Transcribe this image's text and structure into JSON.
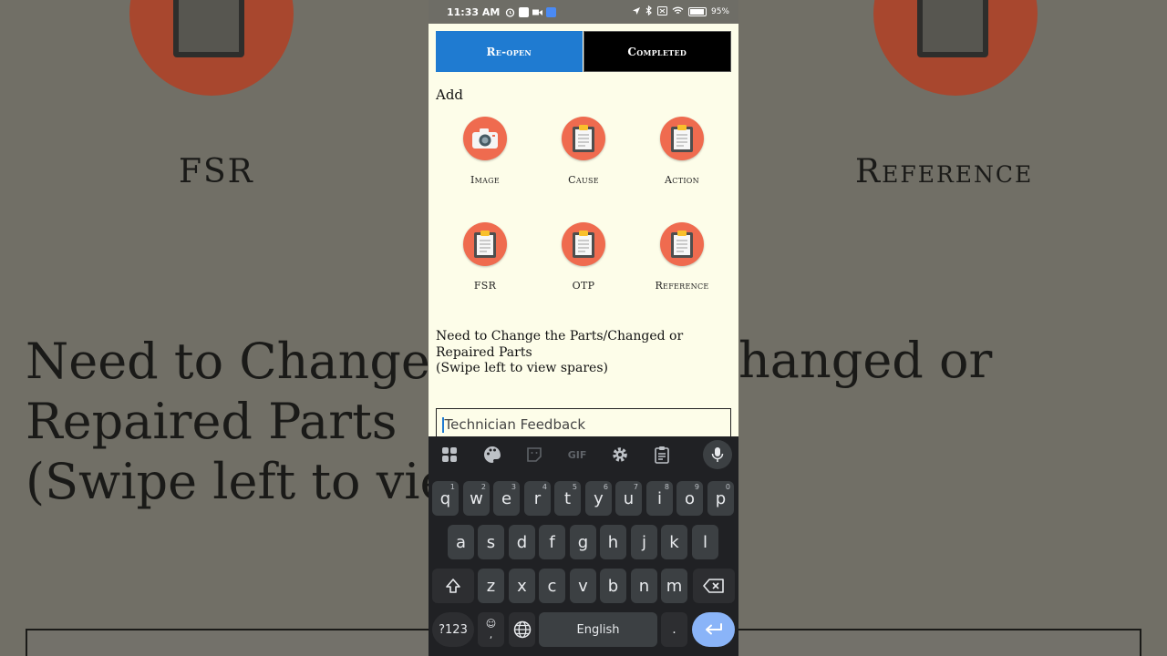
{
  "status_bar": {
    "time": "11:33 AM",
    "battery": "95%",
    "battery_level": 0.95
  },
  "actions": {
    "reopen_label": "Re-open",
    "completed_label": "Completed"
  },
  "add_section": {
    "title": "Add",
    "items": [
      {
        "label": "Image",
        "icon": "camera-icon"
      },
      {
        "label": "Cause",
        "icon": "clipboard-icon"
      },
      {
        "label": "Action",
        "icon": "clipboard-icon"
      },
      {
        "label": "FSR",
        "icon": "clipboard-icon"
      },
      {
        "label": "OTP",
        "icon": "clipboard-icon"
      },
      {
        "label": "Reference",
        "icon": "clipboard-icon"
      }
    ]
  },
  "parts_section": {
    "line1": "Need to Change the Parts/Changed or",
    "line2": "Repaired Parts",
    "line3": "(Swipe left to view spares)"
  },
  "feedback": {
    "placeholder": "Technician Feedback"
  },
  "background_blur": {
    "fsr": "FSR",
    "reference": "Reference",
    "line1": "Need to Change",
    "line1_right": "hanged or",
    "line2": "Repaired Parts",
    "line3": "(Swipe left to vie"
  },
  "keyboard": {
    "toolbar": [
      "apps-icon",
      "palette-icon",
      "sticker-icon",
      "GIF",
      "settings-icon",
      "clipboard-icon",
      "mic-icon"
    ],
    "row1": [
      [
        "q",
        "1"
      ],
      [
        "w",
        "2"
      ],
      [
        "e",
        "3"
      ],
      [
        "r",
        "4"
      ],
      [
        "t",
        "5"
      ],
      [
        "y",
        "6"
      ],
      [
        "u",
        "7"
      ],
      [
        "i",
        "8"
      ],
      [
        "o",
        "9"
      ],
      [
        "p",
        "0"
      ]
    ],
    "row2": [
      "a",
      "s",
      "d",
      "f",
      "g",
      "h",
      "j",
      "k",
      "l"
    ],
    "row3": [
      "z",
      "x",
      "c",
      "v",
      "b",
      "n",
      "m"
    ],
    "symbols_label": "?123",
    "emoji_label": "☺",
    "comma_label": ",",
    "space_label": "English",
    "period_label": "."
  },
  "colors": {
    "accent_blue": "#1f7bd1",
    "tile_orange": "#ef6b4f",
    "page_background": "#fdfde9",
    "keyboard_background": "#202124"
  }
}
